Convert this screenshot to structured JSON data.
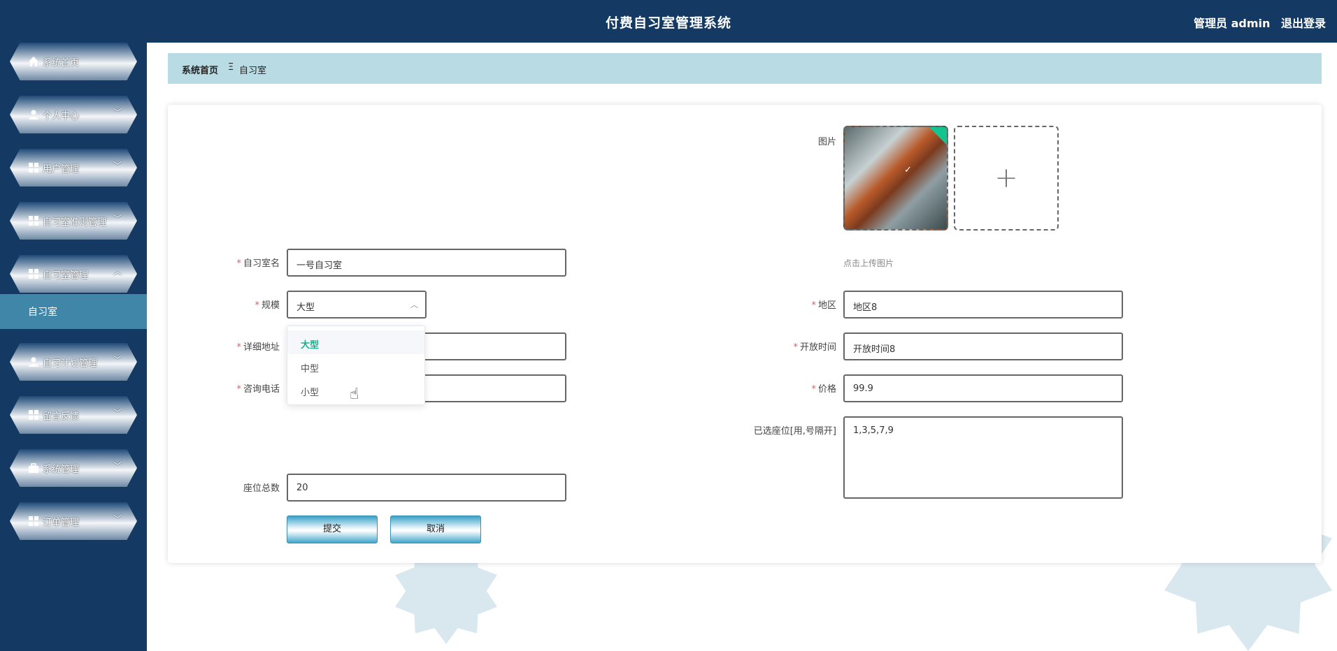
{
  "header": {
    "title": "付费自习室管理系统",
    "user": "管理员 admin",
    "logout": "退出登录"
  },
  "sidebar": {
    "items": [
      {
        "label": "系统首页",
        "icon": "home-icon"
      },
      {
        "label": "个人中心",
        "icon": "person-icon"
      },
      {
        "label": "用户管理",
        "icon": "grid-icon"
      },
      {
        "label": "自习室准则管理",
        "icon": "grid-icon"
      },
      {
        "label": "自习室管理",
        "icon": "grid-icon"
      },
      {
        "label": "自习计划管理",
        "icon": "person-icon"
      },
      {
        "label": "留言反馈",
        "icon": "grid-icon"
      },
      {
        "label": "系统管理",
        "icon": "briefcase-icon"
      },
      {
        "label": "订单管理",
        "icon": "grid-icon"
      }
    ],
    "submenu": "自习室"
  },
  "breadcrumb": {
    "home": "系统首页",
    "separator": "Ξ",
    "current": "自习室"
  },
  "form": {
    "image_label": "图片",
    "upload_hint": "点击上传图片",
    "name": {
      "label": "自习室名",
      "value": "一号自习室"
    },
    "scale": {
      "label": "规模",
      "value": "大型",
      "options": [
        "大型",
        "中型",
        "小型"
      ]
    },
    "address": {
      "label": "详细地址"
    },
    "phone": {
      "label": "咨询电话"
    },
    "seats_total": {
      "label": "座位总数",
      "value": "20"
    },
    "region": {
      "label": "地区",
      "value": "地区8"
    },
    "open_time": {
      "label": "开放时间",
      "value": "开放时间8"
    },
    "price": {
      "label": "价格",
      "value": "99.9"
    },
    "selected_seats": {
      "label": "已选座位[用,号隔开]",
      "value": "1,3,5,7,9"
    },
    "submit": "提交",
    "cancel": "取消"
  },
  "colors": {
    "header_bg": "#143a63",
    "breadcrumb_bg": "#b9dbe4",
    "submenu_bg": "#3f86a8",
    "accent_green": "#16b28a",
    "required": "#e25c5c"
  }
}
